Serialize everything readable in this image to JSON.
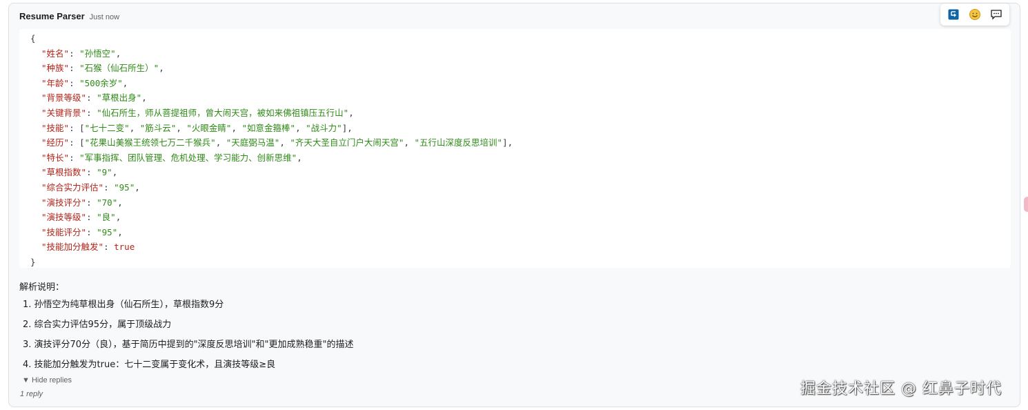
{
  "message": {
    "author": "Resume Parser",
    "time": "Just now"
  },
  "toolbar": {
    "icons": [
      "reply-arrow-icon",
      "emoji-icon",
      "comment-icon"
    ],
    "accent": "#1264a3"
  },
  "code": {
    "open": "{",
    "close": "}",
    "entries": [
      {
        "key": "\"姓名\"",
        "value": "\"孙悟空\"",
        "type": "string"
      },
      {
        "key": "\"种族\"",
        "value": "\"石猴（仙石所生）\"",
        "type": "string"
      },
      {
        "key": "\"年龄\"",
        "value": "\"500余岁\"",
        "type": "string"
      },
      {
        "key": "\"背景等级\"",
        "value": "\"草根出身\"",
        "type": "string"
      },
      {
        "key": "\"关键背景\"",
        "value": "\"仙石所生，师从菩提祖师，曾大闹天宫，被如来佛祖镇压五行山\"",
        "type": "string"
      },
      {
        "key": "\"技能\"",
        "items": [
          "\"七十二变\"",
          "\"筋斗云\"",
          "\"火眼金睛\"",
          "\"如意金箍棒\"",
          "\"战斗力\""
        ],
        "type": "array"
      },
      {
        "key": "\"经历\"",
        "items": [
          "\"花果山美猴王统领七万二千猴兵\"",
          "\"天庭弼马温\"",
          "\"齐天大圣自立门户大闹天宫\"",
          "\"五行山深度反思培训\""
        ],
        "type": "array"
      },
      {
        "key": "\"特长\"",
        "value": "\"军事指挥、团队管理、危机处理、学习能力、创新思维\"",
        "type": "string"
      },
      {
        "key": "\"草根指数\"",
        "value": "\"9\"",
        "type": "string"
      },
      {
        "key": "\"综合实力评估\"",
        "value": "\"95\"",
        "type": "string"
      },
      {
        "key": "\"演技评分\"",
        "value": "\"70\"",
        "type": "string"
      },
      {
        "key": "\"演技等级\"",
        "value": "\"良\"",
        "type": "string"
      },
      {
        "key": "\"技能评分\"",
        "value": "\"95\"",
        "type": "string"
      },
      {
        "key": "\"技能加分触发\"",
        "value": "true",
        "type": "bool"
      }
    ]
  },
  "explanation": {
    "title": "解析说明：",
    "items": [
      "1. 孙悟空为纯草根出身（仙石所生），草根指数9分",
      "2. 综合实力评估95分，属于顶级战力",
      "3. 演技评分70分（良），基于简历中提到的\"深度反思培训\"和\"更加成熟稳重\"的描述",
      "4. 技能加分触发为true：七十二变属于变化术，且演技等级≥良"
    ]
  },
  "thread": {
    "hide_replies": "▼ Hide replies",
    "reply_count": "1 reply"
  },
  "watermark": "掘金技术社区 @ 红鼻子时代"
}
